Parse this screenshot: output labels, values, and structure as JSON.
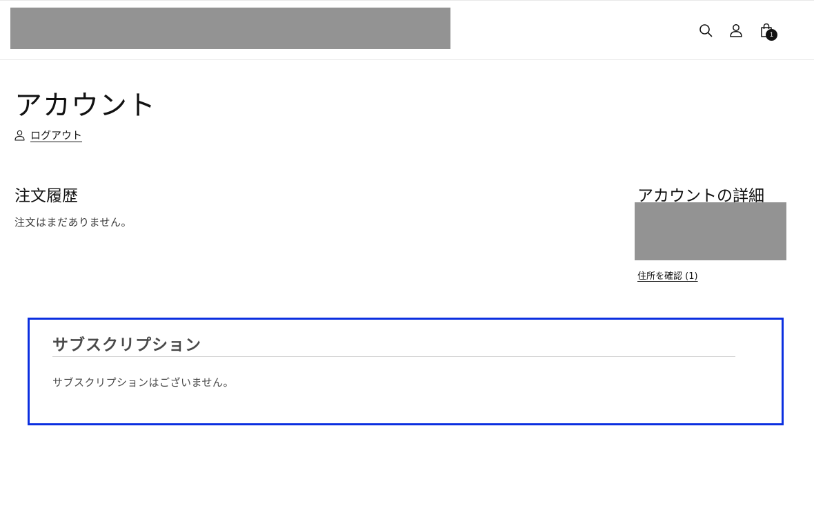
{
  "header": {
    "search_icon": "search-icon",
    "account_icon": "account-icon",
    "cart_icon": "cart-icon",
    "cart_count": "1"
  },
  "account": {
    "title": "アカウント",
    "logout_label": "ログアウト"
  },
  "orders": {
    "heading": "注文履歴",
    "empty_message": "注文はまだありません。"
  },
  "details": {
    "heading": "アカウントの詳細",
    "address_link": "住所を確認 (1)"
  },
  "subscription": {
    "heading": "サブスクリプション",
    "empty_message": "サブスクリプションはございません。",
    "border_color": "#0b2fe0"
  }
}
